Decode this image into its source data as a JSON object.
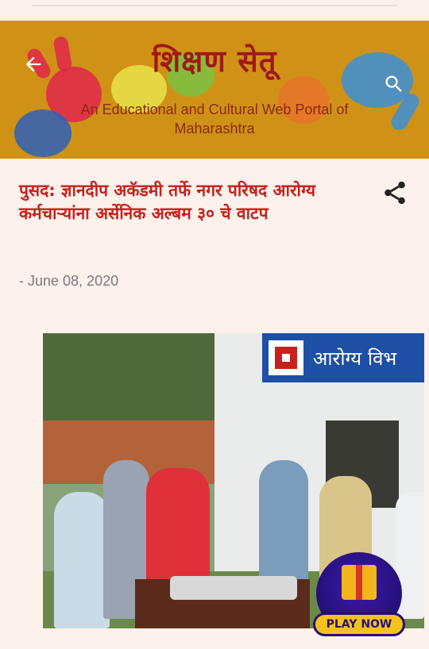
{
  "header": {
    "title": "शिक्षण सेतू",
    "subtitle": "An Educational and Cultural Web Portal of Maharashtra",
    "back_icon": "arrow-left-icon",
    "search_icon": "search-icon"
  },
  "post": {
    "title": "पुसद: ज्ञानदीप अकॅडमी तर्फे नगर परिषद आरोग्य कर्मचाऱ्यांना अर्सेनिक अल्बम ३० चे वाटप",
    "date": "- June 08, 2020",
    "share_icon": "share-icon",
    "photo": {
      "sign_text": "आरोग्य विभ"
    }
  },
  "promo": {
    "label": "PLAY NOW",
    "icon": "gift-icon"
  },
  "colors": {
    "banner_bg": "#cf9216",
    "title_red": "#c8201c",
    "page_bg": "#fdf1ec"
  }
}
